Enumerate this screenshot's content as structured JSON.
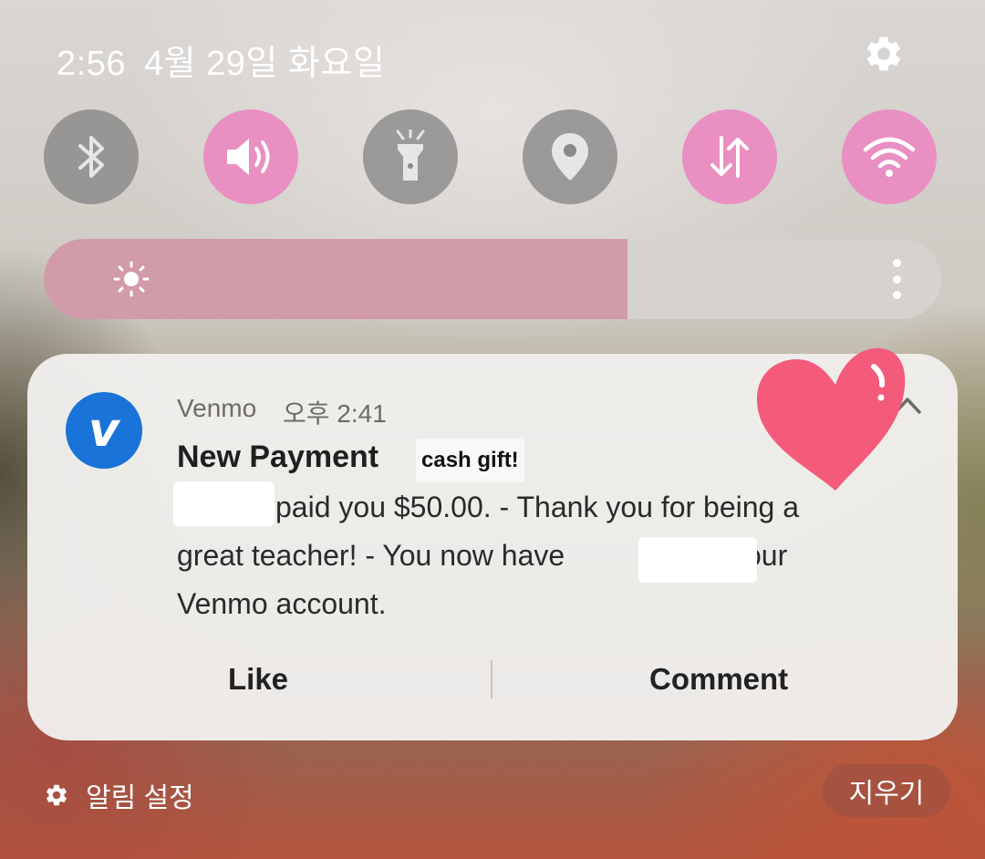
{
  "status": {
    "time": "2:56",
    "date": "4월 29일 화요일"
  },
  "quick_toggles": [
    {
      "icon": "bluetooth-icon",
      "state": "off"
    },
    {
      "icon": "sound-icon",
      "state": "on"
    },
    {
      "icon": "flashlight-icon",
      "state": "off"
    },
    {
      "icon": "location-icon",
      "state": "off"
    },
    {
      "icon": "mobile-data-icon",
      "state": "on"
    },
    {
      "icon": "wifi-icon",
      "state": "on"
    }
  ],
  "brightness": {
    "level": 0.65
  },
  "notification": {
    "app_name": "Venmo",
    "time": "오후 2:41",
    "title": "New Payment",
    "sticker": "cash gift!",
    "line1": "paid you $50.00. - Thank you for being a",
    "line2a": "great teacher! - You now have",
    "line2b": "in your",
    "line3": "Venmo account.",
    "actions": {
      "like": "Like",
      "comment": "Comment"
    }
  },
  "footer": {
    "settings_label": "알림 설정",
    "clear_label": "지우기"
  },
  "colors": {
    "toggle_on": "#e98fc2",
    "brightness_fill": "#d29ba9",
    "venmo_blue": "#1a73d8",
    "heart": "#f45b7a"
  }
}
